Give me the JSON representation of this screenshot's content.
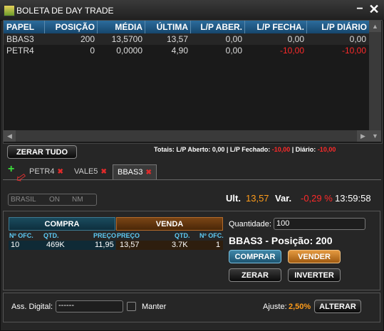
{
  "window": {
    "title": "BOLETA DE DAY TRADE",
    "minimize": "−",
    "close": "✕"
  },
  "grid": {
    "columns": [
      "PAPEL",
      "POSIÇÃO",
      "MÉDIA",
      "ÚLTIMA",
      "L/P ABER.",
      "L/P FECHA.",
      "L/P DIÁRIO"
    ],
    "rows": [
      [
        "BBAS3",
        "200",
        "13,5700",
        "13,57",
        "0,00",
        "0,00",
        "0,00"
      ],
      [
        "PETR4",
        "0",
        "0,0000",
        "4,90",
        "0,00",
        "-10,00",
        "-10,00"
      ]
    ]
  },
  "zerar_tudo": "ZERAR TUDO",
  "totals": {
    "prefix": "Totais: L/P Aberto: 0,00  | L/P Fechado:",
    "fechado": "-10,00",
    "mid": " | Diário:",
    "diario": "-10,00"
  },
  "tabs": {
    "add": "+",
    "items": [
      {
        "label": "PETR4",
        "close": "✖"
      },
      {
        "label": "VALE5",
        "close": "✖"
      },
      {
        "label": "BBAS3",
        "close": "✖"
      }
    ]
  },
  "quote": {
    "status": [
      "BRASIL",
      "ON",
      "NM"
    ],
    "ult_label": "Ult.",
    "ult_value": "13,57",
    "var_label": "Var.",
    "var_value": "-0,29 %",
    "time": "13:59:58"
  },
  "book": {
    "buy_header": "COMPRA",
    "sell_header": "VENDA",
    "buy_cols": [
      "Nº OFC.",
      "QTD.",
      "PREÇO"
    ],
    "sell_cols": [
      "PREÇO",
      "QTD.",
      "Nº OFC."
    ],
    "buy_row": [
      "10",
      "469K",
      "11,95"
    ],
    "sell_row": [
      "13,57",
      "3.7K",
      "1"
    ]
  },
  "order": {
    "qty_label": "Quantidade:",
    "qty_value": "100",
    "position": "BBAS3 - Posição: 200",
    "comprar": "COMPRAR",
    "vender": "VENDER",
    "zerar": "ZERAR",
    "inverter": "INVERTER"
  },
  "bottom": {
    "sig_label": "Ass. Digital:",
    "sig_value": "------",
    "manter": "Manter",
    "ajuste_label": "Ajuste:",
    "ajuste_value": "2,50%",
    "alterar": "ALTERAR"
  },
  "colors": {
    "header": "#1f5a86",
    "negative": "#ff2a2a",
    "accent": "#ff9c1a",
    "buy": "#1a4b5e",
    "sell": "#7a4515"
  }
}
